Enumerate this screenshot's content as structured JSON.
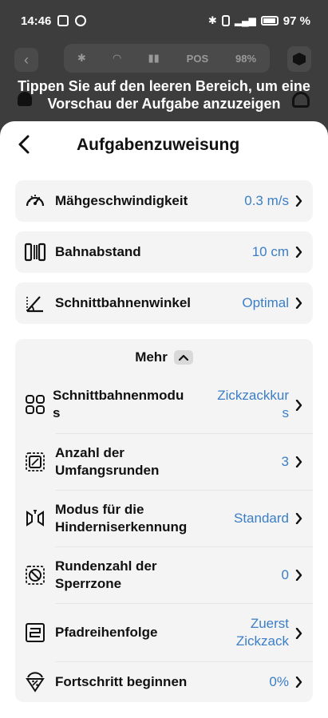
{
  "status_bar": {
    "time": "14:46",
    "battery": "97 %"
  },
  "background": {
    "pos_label": "POS",
    "battery": "98%"
  },
  "hint": "Tippen Sie auf den leeren Bereich, um eine Vorschau der Aufgabe anzuzeigen",
  "sheet": {
    "title": "Aufgabenzuweisung",
    "settings": [
      {
        "label": "Mähgeschwindigkeit",
        "value": "0.3 m/s"
      },
      {
        "label": "Bahnabstand",
        "value": "10 cm"
      },
      {
        "label": "Schnittbahnenwinkel",
        "value": "Optimal"
      }
    ],
    "more": {
      "label": "Mehr",
      "items": [
        {
          "label_1": "Schnittbahnenmodu",
          "label_2": "s",
          "value_1": "Zickzackkur",
          "value_2": "s"
        },
        {
          "label_1": "Anzahl der",
          "label_2": "Umfangsrunden",
          "value": "3"
        },
        {
          "label_1": "Modus für die",
          "label_2": "Hinderniserkennung",
          "value": "Standard"
        },
        {
          "label_1": "Rundenzahl der",
          "label_2": "Sperrzone",
          "value": "0"
        },
        {
          "label": "Pfadreihenfolge",
          "value_1": "Zuerst",
          "value_2": "Zickzack"
        },
        {
          "label": "Fortschritt beginnen",
          "value": "0%"
        }
      ]
    }
  },
  "colors": {
    "accent": "#3b7ec6",
    "card_bg": "#f4f4f4"
  }
}
